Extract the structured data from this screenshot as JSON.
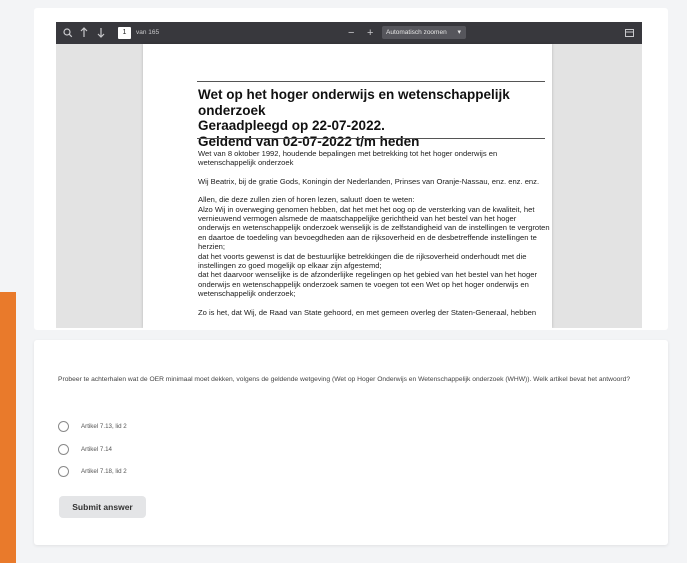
{
  "viewer": {
    "page_number": "1",
    "page_count_label": "van 165",
    "zoom_minus": "−",
    "zoom_plus": "+",
    "zoom_select": "Automatisch zoomen",
    "icons": [
      "search-icon",
      "arrow-up-icon",
      "arrow-down-icon",
      "chevron-down-icon",
      "menu-icon"
    ]
  },
  "document": {
    "title_line1": "Wet op het hoger onderwijs en wetenschappelijk onderzoek",
    "title_line2": "Geraadpleegd op 22-07-2022.",
    "title_line3": "Geldend van 02-07-2022 t/m heden",
    "para1": "Wet van 8 oktober 1992, houdende bepalingen met betrekking tot het hoger onderwijs en wetenschappelijk onderzoek",
    "para2": "Wij Beatrix, bij de gratie Gods, Koningin der Nederlanden, Prinses van Oranje-Nassau, enz. enz. enz.",
    "para3": "Allen, die deze zullen zien of horen lezen, saluut! doen te weten:",
    "para4": "Alzo Wij in overweging genomen hebben, dat het met het oog op de versterking van de kwaliteit, het vernieuwend vermogen alsmede de maatschappelijke gerichtheid van het bestel van het hoger onderwijs en wetenschappelijk onderzoek wenselijk is de zelfstandigheid van de instellingen te vergroten en daartoe de toedeling van bevoegdheden aan de rijksoverheid en de desbetreffende instellingen te herzien;",
    "para5": "dat het voorts gewenst is dat de bestuurlijke betrekkingen die de rijksoverheid onderhoudt met die instellingen zo goed mogelijk op elkaar zijn afgestemd;",
    "para6": "dat het daarvoor wenselijke is de afzonderlijke regelingen op het gebied van het bestel van het hoger onderwijs en wetenschappelijk onderzoek samen te voegen tot een Wet op het hoger onderwijs en wetenschappelijk onderzoek;",
    "para7": "Zo is het, dat Wij, de Raad van State gehoord, en met gemeen overleg der Staten-Generaal, hebben"
  },
  "quiz": {
    "question": "Probeer te achterhalen wat de OER minimaal moet dekken, volgens de geldende wetgeving (Wet op Hoger Onderwijs en Wetenschappelijk onderzoek (WHW)). Welk artikel bevat het antwoord?",
    "options": [
      "Artikel 7.13, lid 2",
      "Artikel 7.14",
      "Artikel 7.18, lid 2"
    ],
    "submit_label": "Submit answer"
  },
  "colors": {
    "accent": "#e97a2b",
    "toolbar": "#38383d"
  }
}
